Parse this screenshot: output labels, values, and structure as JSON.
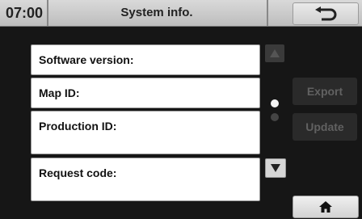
{
  "header": {
    "clock": "07:00",
    "title": "System info.",
    "back_icon": "back-arrow-icon"
  },
  "info_rows": [
    {
      "label": "Software version:",
      "value": ""
    },
    {
      "label": "Map ID:",
      "value": ""
    },
    {
      "label": "Production ID:",
      "value": ""
    },
    {
      "label": "Request code:",
      "value": ""
    }
  ],
  "scroll": {
    "up_icon": "triangle-up-icon",
    "down_icon": "triangle-down-icon",
    "page_count": 2,
    "current_page": 1
  },
  "side_buttons": {
    "export_label": "Export",
    "update_label": "Update"
  },
  "footer": {
    "home_icon": "home-icon"
  },
  "colors": {
    "header_bg": "#cfcfcf",
    "screen_bg": "#161616",
    "row_bg": "#ffffff",
    "disabled_text": "#616161"
  }
}
